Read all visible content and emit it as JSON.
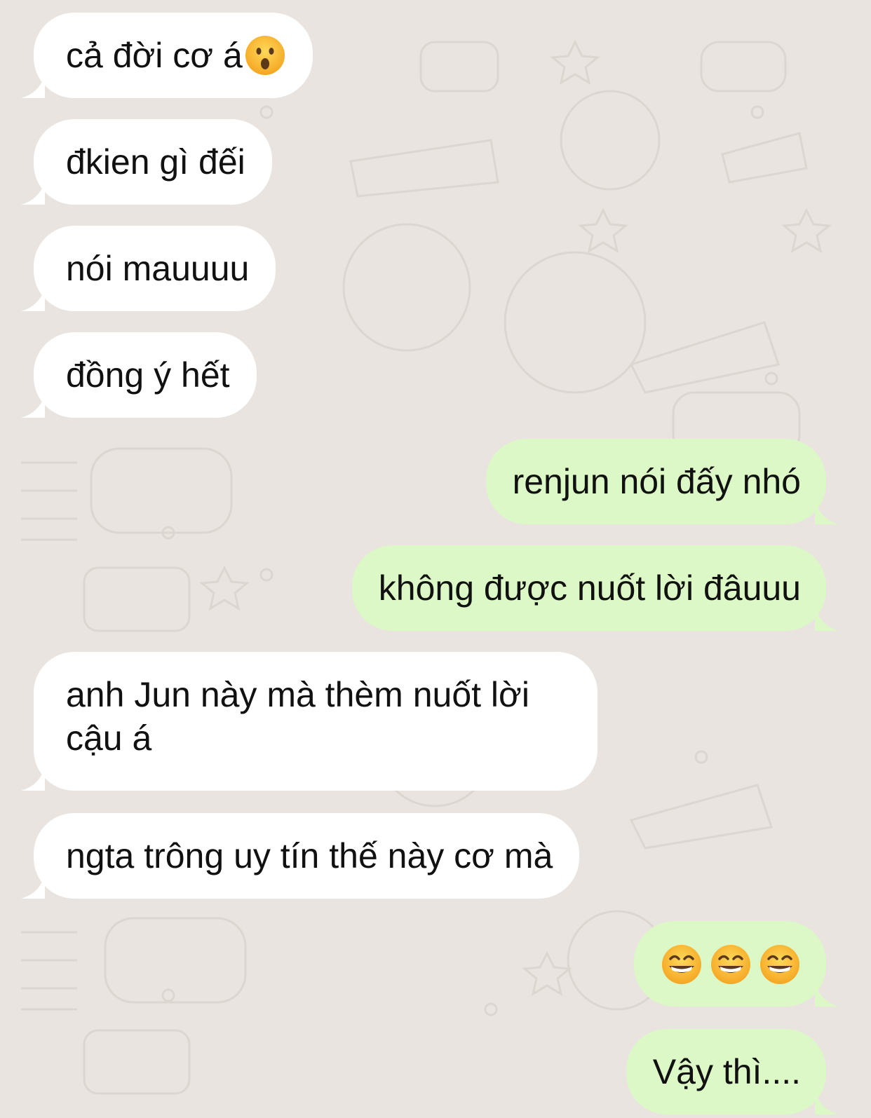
{
  "messages": [
    {
      "direction": "incoming",
      "text": "cả đời cơ á",
      "trailing_emoji": "face-with-open-mouth-emoji"
    },
    {
      "direction": "incoming",
      "text": "đkien gì đếi"
    },
    {
      "direction": "incoming",
      "text": "nói mauuuu"
    },
    {
      "direction": "incoming",
      "text": "đồng ý hết"
    },
    {
      "direction": "outgoing",
      "text": "renjun nói đấy nhó"
    },
    {
      "direction": "outgoing",
      "text": "không được nuốt lời đâuuu"
    },
    {
      "direction": "incoming",
      "text": "anh Jun này mà thèm nuốt lời cậu á"
    },
    {
      "direction": "incoming",
      "text": "ngta trông uy tín thế này cơ mà"
    },
    {
      "direction": "outgoing",
      "emojis": [
        "grinning-face-with-smiling-eyes-emoji",
        "grinning-face-with-smiling-eyes-emoji",
        "grinning-face-with-smiling-eyes-emoji"
      ]
    },
    {
      "direction": "outgoing",
      "text": "Vậy thì...."
    }
  ],
  "colors": {
    "background": "#e9e4df",
    "incoming_bubble": "#ffffff",
    "outgoing_bubble": "#dcf8c6",
    "text": "#111111"
  }
}
